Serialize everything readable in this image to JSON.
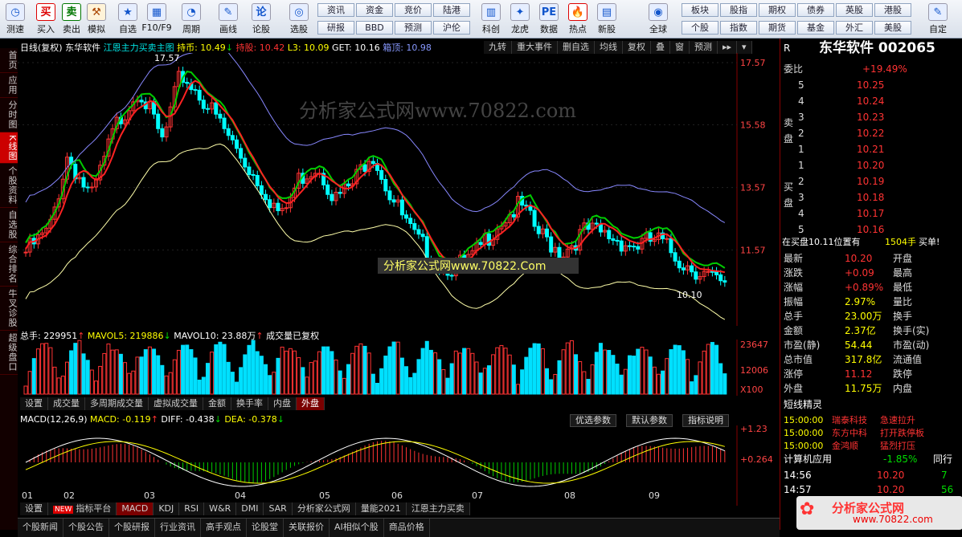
{
  "toolbar": {
    "left": [
      "测速"
    ],
    "items": [
      "买入",
      "卖出",
      "模拟",
      "自选",
      "F10/F9",
      "周期",
      "画线",
      "论股",
      "选股"
    ],
    "mini_top": [
      "资讯",
      "资金",
      "竞价",
      "陆港"
    ],
    "mini_bot": [
      "研报",
      "BBD",
      "预测",
      "沪伦"
    ],
    "items2": [
      "科创",
      "龙虎",
      "数据",
      "热点",
      "新股"
    ],
    "global": "全球",
    "mini2_top": [
      "板块",
      "股指",
      "期权",
      "债券",
      "英股",
      "港股"
    ],
    "mini2_bot": [
      "个股",
      "指数",
      "期货",
      "基金",
      "外汇",
      "美股"
    ],
    "custom": "自定"
  },
  "sidebar": [
    "首页",
    "应用",
    "分时图",
    "K线图",
    "个股资料",
    "自选股",
    "综合排名",
    "牛叉诊股",
    "超级盘口"
  ],
  "kline": {
    "header": {
      "title": "日线(复权)",
      "name": "东华软件",
      "indicator": "江恩主力买卖主图",
      "hold": "持币: 10.49",
      "hold_arrow": "↓",
      "holdstock": "持股: 10.42",
      "l3": "L3: 10.09",
      "get": "GET: 10.16",
      "box": "箱顶: 10.98"
    },
    "buttons": [
      "九转",
      "重大事件",
      "删自选",
      "均线",
      "复权",
      "叠",
      "窗",
      "预测"
    ],
    "price_axis": [
      "17.57",
      "15.58",
      "13.57",
      "11.57"
    ],
    "high_label": "17.57",
    "low_label": "10.10",
    "watermark": "分析家公式网www.70822.com",
    "watermark2": "分析家公式网www.70822.Com"
  },
  "volume": {
    "header": {
      "total": "总手: 229951",
      "total_arrow": "↑",
      "mavol5": "MAVOL5: 219886",
      "mavol5_arrow": "↓",
      "mavol10": "MAVOL10: 23.88万",
      "mavol10_arrow": "↑",
      "note": "成交量已复权"
    },
    "axis": [
      "23647",
      "12006",
      "X100"
    ],
    "tabs": [
      "设置",
      "成交量",
      "多周期成交量",
      "虚拟成交量",
      "金额",
      "换手率",
      "内盘",
      "外盘"
    ]
  },
  "macd": {
    "header": {
      "name": "MACD(12,26,9)",
      "macd": "MACD: -0.119",
      "macd_arrow": "↑",
      "diff": "DIFF: -0.438",
      "diff_arrow": "↓",
      "dea": "DEA: -0.378",
      "dea_arrow": "↓"
    },
    "right_btns": [
      "优选参数",
      "默认参数",
      "指标说明"
    ],
    "axis": [
      "+1.23",
      "+0.264"
    ],
    "months": [
      "01",
      "02",
      "03",
      "04",
      "05",
      "06",
      "07",
      "08",
      "09"
    ]
  },
  "tabs": {
    "items": [
      "设置",
      "指标平台",
      "MACD",
      "KDJ",
      "RSI",
      "W&R",
      "DMI",
      "SAR",
      "分析家公式网",
      "量能2021",
      "江恩主力买卖"
    ],
    "new_badge": "NEW"
  },
  "bottom_tabs": [
    "个股新闻",
    "个股公告",
    "个股研报",
    "行业资讯",
    "高手观点",
    "论股堂",
    "关联报价",
    "AI相似个股",
    "商品价格"
  ],
  "quote": {
    "name": "东华软件 002065",
    "r": "R",
    "ratio_label": "委比",
    "ratio": "+19.49%",
    "sell_label": "卖盘",
    "buy_label": "买盘",
    "sell": [
      [
        "5",
        "10.25"
      ],
      [
        "4",
        "10.24"
      ],
      [
        "3",
        "10.23"
      ],
      [
        "2",
        "10.22"
      ],
      [
        "1",
        "10.21"
      ]
    ],
    "buy": [
      [
        "1",
        "10.20"
      ],
      [
        "2",
        "10.19"
      ],
      [
        "3",
        "10.18"
      ],
      [
        "4",
        "10.17"
      ],
      [
        "5",
        "10.16"
      ]
    ],
    "note": "在买盘10.11位置有",
    "note_vol": "1504手",
    "note_act": "买单!",
    "stats": [
      [
        "最新",
        "10.20",
        "开盘"
      ],
      [
        "涨跌",
        "+0.09",
        "最高"
      ],
      [
        "涨幅",
        "+0.89%",
        "最低"
      ],
      [
        "振幅",
        "2.97%",
        "量比"
      ],
      [
        "总手",
        "23.00万",
        "换手"
      ],
      [
        "金额",
        "2.37亿",
        "换手(实)"
      ],
      [
        "市盈(静)",
        "54.44",
        "市盈(动)"
      ],
      [
        "总市值",
        "317.8亿",
        "流通值"
      ],
      [
        "涨停",
        "11.12",
        "跌停"
      ],
      [
        "外盘",
        "11.75万",
        "内盘"
      ]
    ],
    "elf_title": "短线精灵",
    "elf": [
      [
        "15:00:00",
        "瑞泰科技",
        "急速拉升"
      ],
      [
        "15:00:00",
        "东方中科",
        "打开跌停板"
      ],
      [
        "15:00:00",
        "金鸿顺",
        "猛烈打压"
      ]
    ],
    "sector": "计算机应用",
    "sector_val": "-1.85%",
    "sector_right": "同行",
    "ticks": [
      [
        "14:56",
        "10.20",
        "7"
      ],
      [
        "14:57",
        "10.20",
        "56"
      ]
    ],
    "logo": "分析家公式网",
    "logo_url": "www.70822.com"
  }
}
